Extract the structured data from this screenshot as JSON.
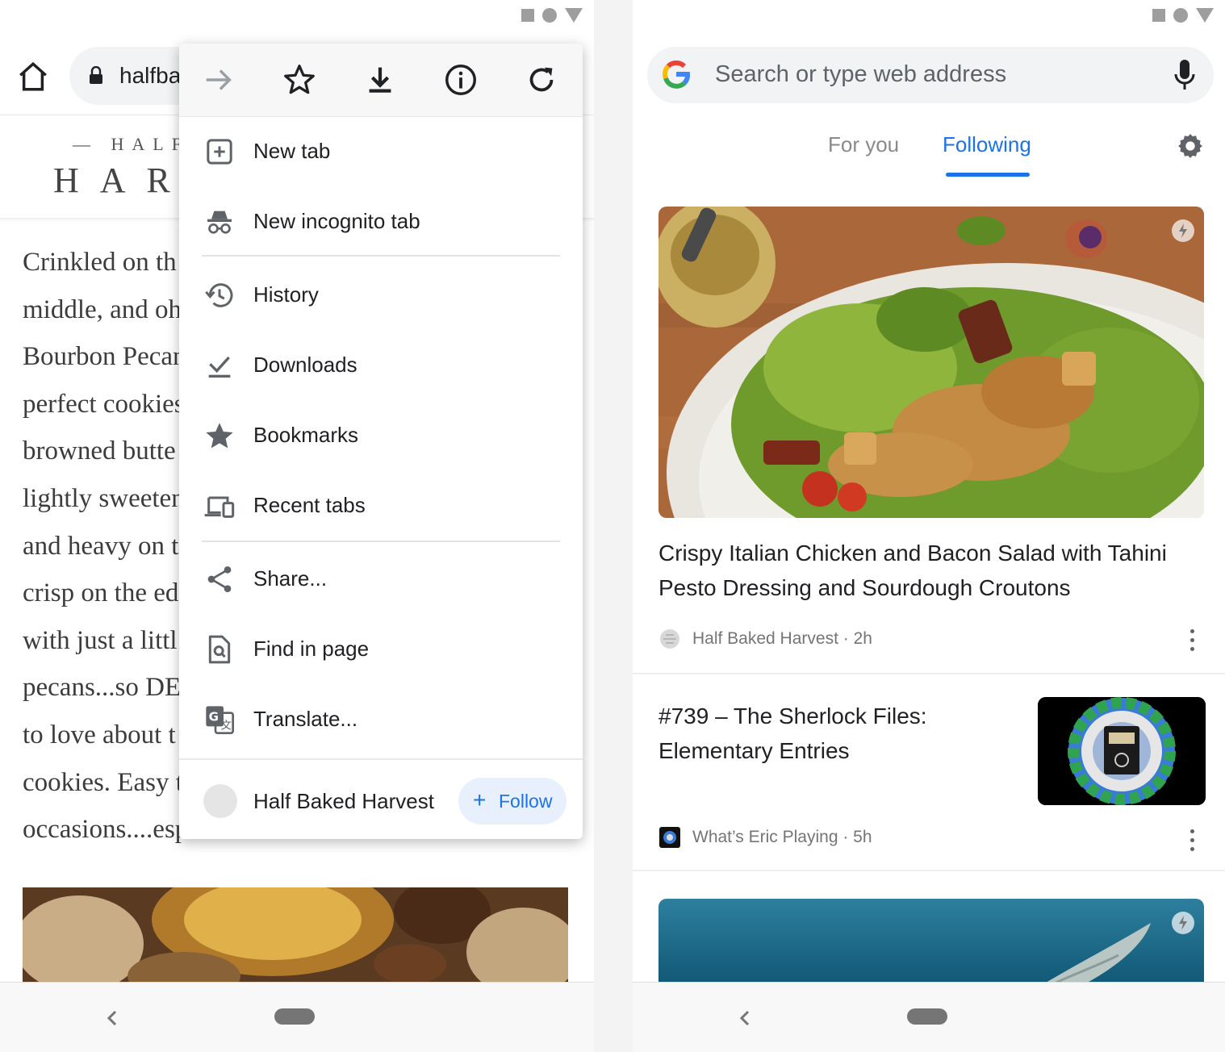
{
  "left": {
    "url": "halfba",
    "site_logo_small": "— HALF",
    "site_logo_big": "HAR",
    "article_lines": [
      "Crinkled on th",
      "middle, and oh",
      "Bourbon Pecan",
      "perfect cookies",
      "browned butte",
      "lightly sweeten",
      "and heavy on t",
      "crisp on the ed",
      "with just a littl",
      "pecans...so DE",
      "to love about t",
      "cookies. Easy t",
      "occasions....esp"
    ],
    "menu": {
      "items": [
        {
          "label": "New tab"
        },
        {
          "label": "New incognito tab"
        },
        {
          "label": "History"
        },
        {
          "label": "Downloads"
        },
        {
          "label": "Bookmarks"
        },
        {
          "label": "Recent tabs"
        },
        {
          "label": "Share..."
        },
        {
          "label": "Find in page"
        },
        {
          "label": "Translate..."
        }
      ],
      "footer_site": "Half Baked Harvest",
      "follow_plus": "+",
      "follow_label": "Follow"
    }
  },
  "right": {
    "search_placeholder": "Search or type web address",
    "tabs": [
      "For you",
      "Following"
    ],
    "active_tab": "Following",
    "cards": [
      {
        "title": "Crispy Italian Chicken and Bacon Salad with Tahini Pesto Dressing and Sourdough Croutons",
        "meta": "Half Baked Harvest · 2h"
      },
      {
        "title": "#739 – The Sherlock Files: Elementary Entries",
        "meta": "What’s Eric Playing · 5h"
      }
    ]
  },
  "colors": {
    "accent": "#1a73e8",
    "follow_bg": "#e8f0fe",
    "omnibox_bg": "#f1f3f4"
  }
}
